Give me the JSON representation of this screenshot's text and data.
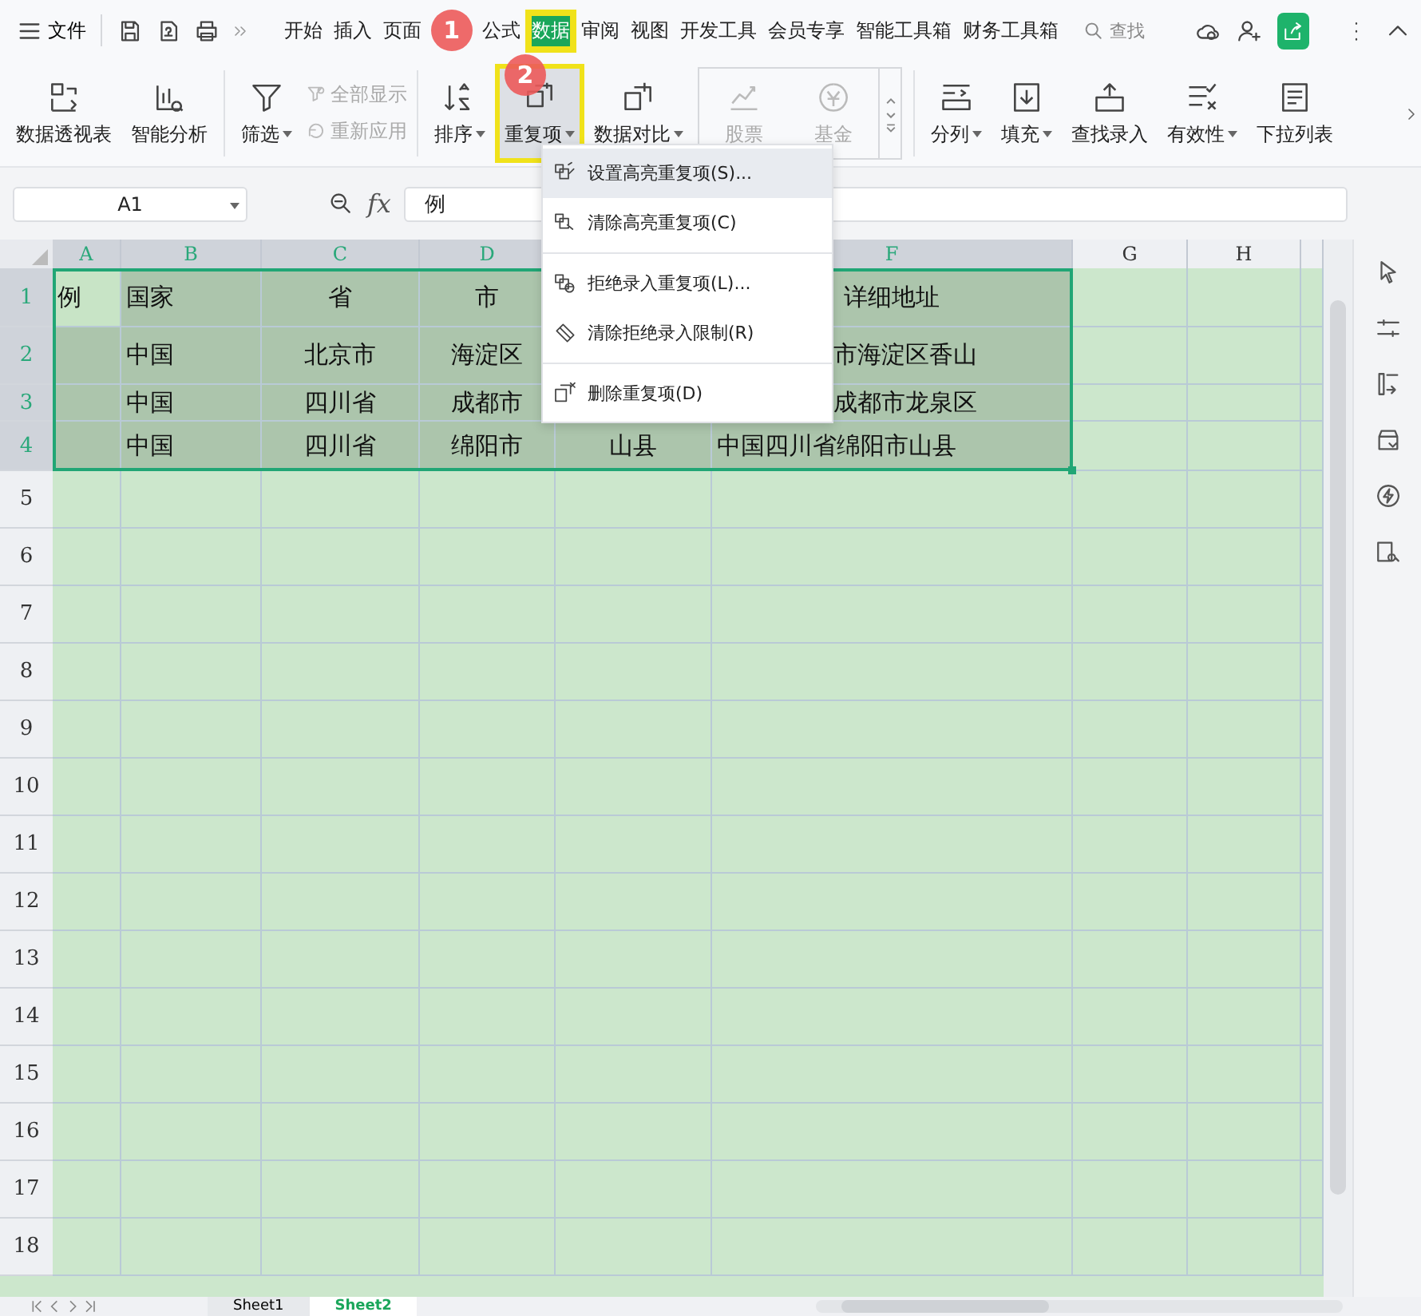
{
  "title_bar": {
    "menu_label": "文件",
    "tabs": [
      {
        "label": "开始",
        "selected": false,
        "highlighted": false
      },
      {
        "label": "插入",
        "selected": false,
        "highlighted": false
      },
      {
        "label": "页面",
        "selected": false,
        "highlighted": false
      },
      {
        "label": "公式",
        "selected": false,
        "highlighted": false
      },
      {
        "label": "数据",
        "selected": true,
        "highlighted": true
      },
      {
        "label": "审阅",
        "selected": false,
        "highlighted": false
      },
      {
        "label": "视图",
        "selected": false,
        "highlighted": false
      },
      {
        "label": "开发工具",
        "selected": false,
        "highlighted": false
      },
      {
        "label": "会员专享",
        "selected": false,
        "highlighted": false
      },
      {
        "label": "智能工具箱",
        "selected": false,
        "highlighted": false
      },
      {
        "label": "财务工具箱",
        "selected": false,
        "highlighted": false
      }
    ],
    "search": {
      "placeholder": "查找"
    }
  },
  "ribbon_groups": [
    [
      {
        "kind": "large",
        "label": "数据透视表",
        "dropdown": false,
        "pressed": false,
        "highlighted": false
      },
      {
        "kind": "large",
        "label": "智能分析",
        "dropdown": false,
        "pressed": false,
        "highlighted": false
      }
    ],
    [
      {
        "kind": "large",
        "label": "筛选",
        "dropdown": true,
        "pressed": false,
        "highlighted": false
      },
      {
        "kind": "stack",
        "items": [
          {
            "label": "全部显示",
            "disabled": true
          },
          {
            "label": "重新应用",
            "disabled": true
          }
        ]
      }
    ],
    [
      {
        "kind": "large",
        "label": "排序",
        "dropdown": true,
        "pressed": false,
        "highlighted": false
      },
      {
        "kind": "large",
        "label": "重复项",
        "dropdown": true,
        "pressed": true,
        "highlighted": true
      },
      {
        "kind": "large",
        "label": "数据对比",
        "dropdown": true,
        "pressed": false,
        "highlighted": false
      },
      {
        "kind": "gallery",
        "items": [
          {
            "label": "股票",
            "disabled": true
          },
          {
            "label": "基金",
            "disabled": true
          }
        ]
      }
    ],
    [
      {
        "kind": "large",
        "label": "分列",
        "dropdown": true,
        "pressed": false,
        "highlighted": false
      },
      {
        "kind": "large",
        "label": "填充",
        "dropdown": true,
        "pressed": false,
        "highlighted": false
      },
      {
        "kind": "large",
        "label": "查找录入",
        "dropdown": false,
        "pressed": false,
        "highlighted": false
      },
      {
        "kind": "large",
        "label": "有效性",
        "dropdown": true,
        "pressed": false,
        "highlighted": false
      },
      {
        "kind": "large",
        "label": "下拉列表",
        "dropdown": false,
        "pressed": false,
        "highlighted": false
      }
    ]
  ],
  "formula_bar": {
    "name_box": "A1",
    "fx": "fx",
    "value": "例"
  },
  "columns": [
    {
      "label": "A",
      "selected": true
    },
    {
      "label": "B",
      "selected": true
    },
    {
      "label": "C",
      "selected": true
    },
    {
      "label": "D",
      "selected": true
    },
    null,
    {
      "label": "F",
      "selected": true
    },
    {
      "label": "G",
      "selected": false
    },
    {
      "label": "H",
      "selected": false
    }
  ],
  "rows": [
    {
      "label": "1",
      "selected": true,
      "cells": [
        {
          "text": "例",
          "active": true
        },
        {
          "text": "国家",
          "active": false
        },
        {
          "text": "省",
          "active": false
        },
        {
          "text": "市",
          "active": false
        },
        null,
        {
          "text": "详细地址",
          "active": false
        }
      ]
    },
    {
      "label": "2",
      "selected": true,
      "cells": [
        null,
        {
          "text": "中国",
          "active": false
        },
        {
          "text": "北京市",
          "active": false
        },
        {
          "text": "海淀区",
          "active": false
        },
        null,
        {
          "text": "市海淀区香山",
          "active": false,
          "clipped_left": true
        }
      ]
    },
    {
      "label": "3",
      "selected": true,
      "cells": [
        null,
        {
          "text": "中国",
          "active": false
        },
        {
          "text": "四川省",
          "active": false
        },
        {
          "text": "成都市",
          "active": false
        },
        null,
        {
          "text": "成都市龙泉区",
          "active": false,
          "clipped_left": true
        }
      ]
    },
    {
      "label": "4",
      "selected": true,
      "cells": [
        null,
        {
          "text": "中国",
          "active": false
        },
        {
          "text": "四川省",
          "active": false
        },
        {
          "text": "绵阳市",
          "active": false
        },
        {
          "text": "山县",
          "active": false
        },
        {
          "text": "中国四川省绵阳市山县",
          "active": false
        }
      ]
    },
    {
      "label": "5",
      "selected": false
    },
    {
      "label": "6",
      "selected": false
    },
    {
      "label": "7",
      "selected": false
    },
    {
      "label": "8",
      "selected": false
    },
    {
      "label": "9",
      "selected": false
    },
    {
      "label": "10",
      "selected": false
    },
    {
      "label": "11",
      "selected": false
    },
    {
      "label": "12",
      "selected": false
    },
    {
      "label": "13",
      "selected": false
    },
    {
      "label": "14",
      "selected": false
    },
    {
      "label": "15",
      "selected": false
    },
    {
      "label": "16",
      "selected": false
    },
    {
      "label": "17",
      "selected": false
    },
    {
      "label": "18",
      "selected": false
    }
  ],
  "dropdown_menu_groups": [
    [
      {
        "label": "设置高亮重复项(S)...",
        "hovered": true
      },
      {
        "label": "清除高亮重复项(C)",
        "hovered": false
      }
    ],
    [
      {
        "label": "拒绝录入重复项(L)...",
        "hovered": false
      },
      {
        "label": "清除拒绝录入限制(R)",
        "hovered": false
      }
    ],
    [
      {
        "label": "删除重复项(D)",
        "hovered": false
      }
    ]
  ],
  "step_markers": [
    {
      "label": "1"
    },
    {
      "label": "2"
    }
  ],
  "sheet_tabs": [
    {
      "label": "Sheet1",
      "selected": false
    },
    {
      "label": "Sheet2",
      "selected": true
    }
  ]
}
